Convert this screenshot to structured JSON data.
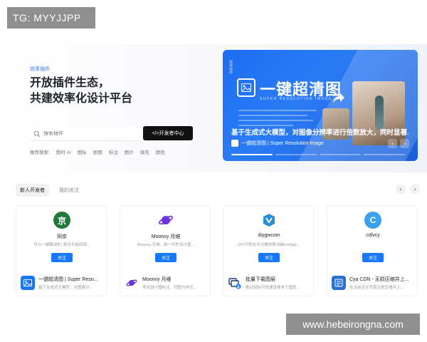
{
  "watermarks": {
    "top_left": "TG: MYYJJPP",
    "bottom_right": "www.hebeirongna.com"
  },
  "hero": {
    "eyebrow": "效率插件",
    "headline_line1": "开放插件生态，",
    "headline_line2": "共建效率化设计平台",
    "search": {
      "placeholder": "搜索插件",
      "icon": "search-icon"
    },
    "dev_center_button": "</>开发者中心",
    "hot_label": "推荐搜索:",
    "hot_tags": [
      "图时 AI",
      "图标",
      "抠图",
      "标注",
      "图片",
      "填充",
      "颜色"
    ]
  },
  "banner": {
    "side_text": "效率插件",
    "title": "一键超清图",
    "subtitle": "SUPER RESOLUTION IMAGE",
    "caption": "基于生成式大模型，对图像分辨率进行倍数放大，同时显著...",
    "meta": "一键超清图 | Super Resolution Image",
    "prev": "‹",
    "next": "›",
    "progress_active_index": 0
  },
  "tabs": [
    {
      "label": "新人开发者",
      "active": true
    },
    {
      "label": "我的关注",
      "active": false
    }
  ],
  "nav": {
    "prev": "‹",
    "next": "›"
  },
  "developers": [
    {
      "name": "同京",
      "desc": "可以一键解决的, 绝对不能同调...",
      "avatar_char": "京",
      "avatar_color": "#1f7a3a",
      "follow": "关注",
      "plugin": {
        "title": "一键超清图 | Super Reso...",
        "desc": "基于生成式大模型，对图像分...",
        "icon": "image-enhance-icon",
        "color": "#1677ff"
      }
    },
    {
      "name": "Moonvy 月维",
      "desc": "Moonvy 月维，新一代的设计管...",
      "avatar_char": "",
      "avatar_color": "#ffffff",
      "follow": "关注",
      "plugin": {
        "title": "Moonvy 月维",
        "desc": "导出设计图标注、切图与样式...",
        "icon": "planet-icon",
        "color": "#ffffff"
      }
    },
    {
      "name": "diygwcom",
      "desc": "DIY可视化专注微信移动端UniApp...",
      "avatar_char": "",
      "avatar_color": "#ffffff",
      "follow": "关注",
      "plugin": {
        "title": "批量下载图层",
        "desc": "拖动鼠标可快速选择多个图层...",
        "icon": "batch-download-icon",
        "color": "#ffffff"
      }
    },
    {
      "name": "cdlvcy",
      "desc": "",
      "avatar_char": "C",
      "avatar_color": "#3aa0f0",
      "follow": "关注",
      "plugin": {
        "title": "Cya CDN - 无损压缩并上...",
        "desc": "在当前设计页面无损压缩并上...",
        "icon": "cdn-icon",
        "color": "#2a6fd6"
      }
    }
  ]
}
